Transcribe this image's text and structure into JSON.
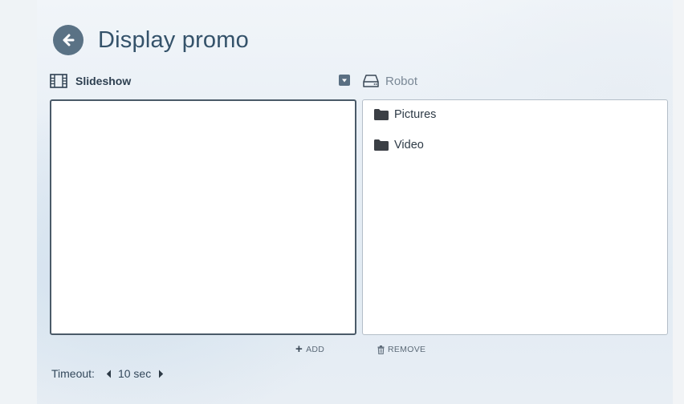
{
  "header": {
    "title": "Display promo",
    "back_icon": "arrow-left-circle-icon"
  },
  "slideshow": {
    "label": "Slideshow",
    "icon": "film-strip-icon",
    "collapse_icon": "collapse-square-icon",
    "items": []
  },
  "robot": {
    "label": "Robot",
    "icon": "hard-drive-icon",
    "folders": [
      {
        "name": "Pictures",
        "icon": "folder-icon"
      },
      {
        "name": "Video",
        "icon": "folder-icon"
      }
    ]
  },
  "actions": {
    "add_label": "ADD",
    "add_icon": "plus-icon",
    "remove_label": "REMOVE",
    "remove_icon": "trash-icon"
  },
  "timeout": {
    "label": "Timeout:",
    "value": "10 sec"
  },
  "colors": {
    "accent": "#5a7285",
    "title": "#34526a",
    "panel_border": "#4a5a68"
  }
}
